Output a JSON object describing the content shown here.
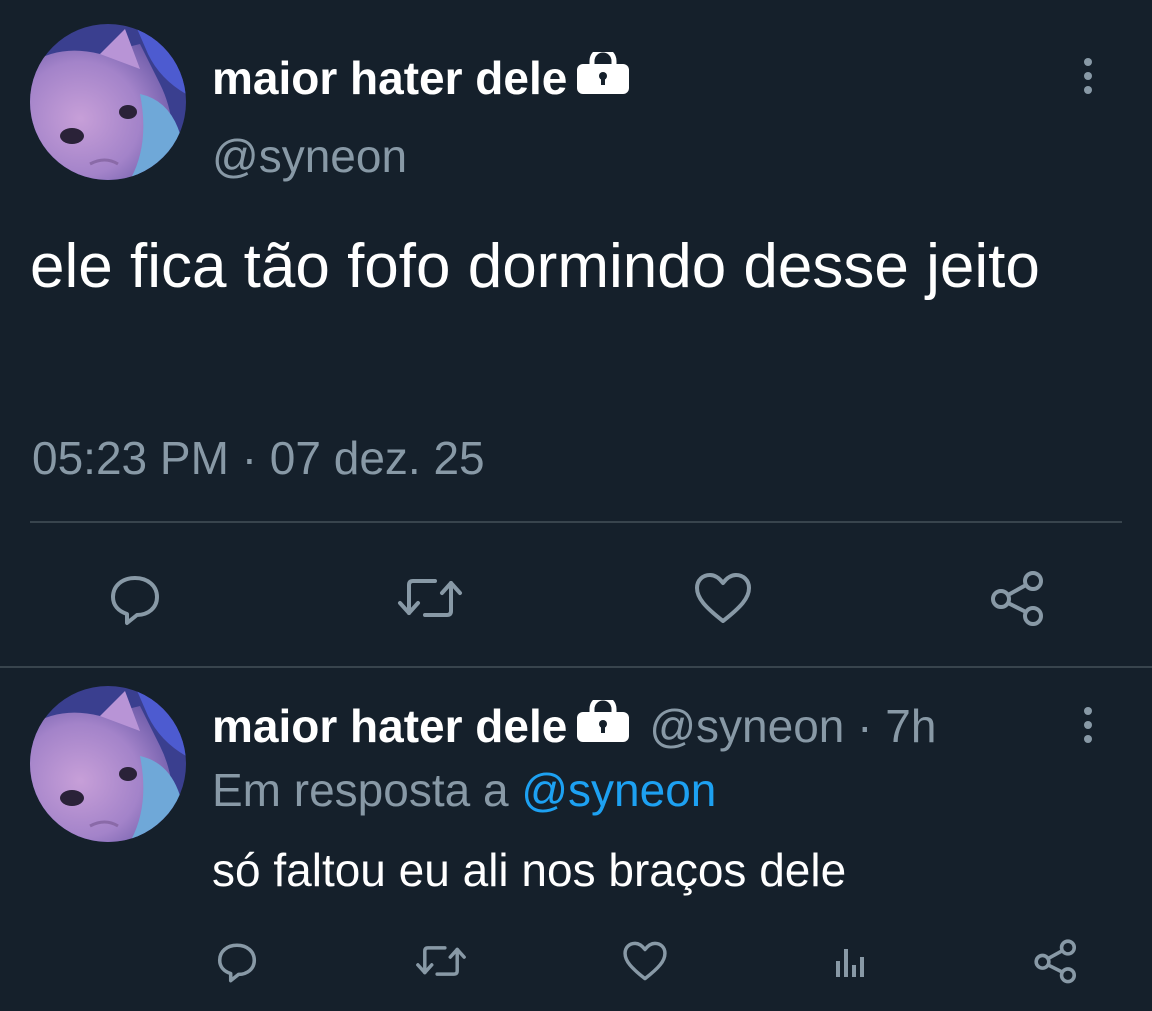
{
  "main_tweet": {
    "display_name": "maior hater dele",
    "handle": "@syneon",
    "text": "ele fica tão fofo dormindo desse jeito",
    "time": "05:23 PM",
    "separator": "·",
    "date": "07 dez. 25"
  },
  "reply_tweet": {
    "display_name": "maior hater dele",
    "handle": "@syneon",
    "separator": "·",
    "age": "7h",
    "in_reply_prefix": "Em resposta a",
    "in_reply_mention": "@syneon",
    "text": "só faltou eu ali nos braços dele"
  },
  "colors": {
    "background": "#15202b",
    "secondary_text": "#8899a6",
    "divider": "#38444d",
    "link": "#1da1f2"
  },
  "icons": {
    "verified_lock": "lock-icon",
    "more": "more-vertical-icon",
    "reply": "reply-icon",
    "retweet": "retweet-icon",
    "like": "heart-icon",
    "share": "share-icon",
    "analytics": "analytics-icon"
  }
}
